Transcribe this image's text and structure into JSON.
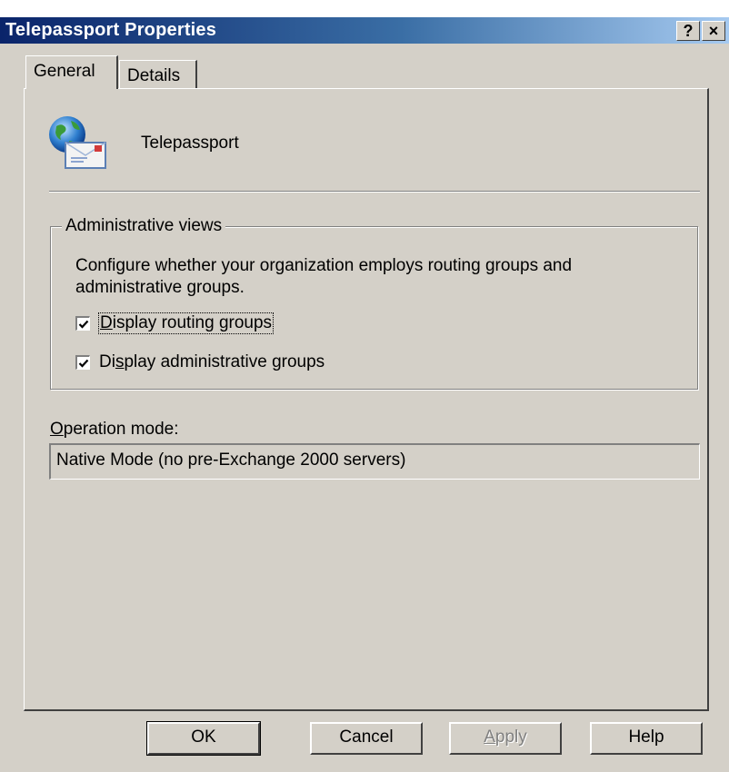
{
  "window": {
    "title": "Telepassport Properties",
    "help_button": "?",
    "close_button": "×"
  },
  "tabs": [
    {
      "label": "General",
      "active": true
    },
    {
      "label": "Details",
      "active": false
    }
  ],
  "general": {
    "object_name": "Telepassport",
    "object_icon": "exchange-org-globe-mail-icon",
    "admin_views": {
      "legend": "Administrative views",
      "description": "Configure whether your organization employs routing groups and administrative groups.",
      "checkboxes": [
        {
          "label_pre": "",
          "label_accel": "D",
          "label_post": "isplay routing groups",
          "checked": true
        },
        {
          "label_pre": "Di",
          "label_accel": "s",
          "label_post": "play administrative groups",
          "checked": true
        }
      ]
    },
    "operation_mode": {
      "label_accel": "O",
      "label_rest": "peration mode:",
      "value": "Native Mode (no pre-Exchange 2000 servers)"
    }
  },
  "buttons": {
    "ok": "OK",
    "cancel": "Cancel",
    "apply_accel": "A",
    "apply_rest": "pply",
    "help": "Help"
  },
  "colors": {
    "dialog_face": "#d4d0c8",
    "titlebar_start": "#0a246a",
    "titlebar_end": "#a6caf0"
  }
}
